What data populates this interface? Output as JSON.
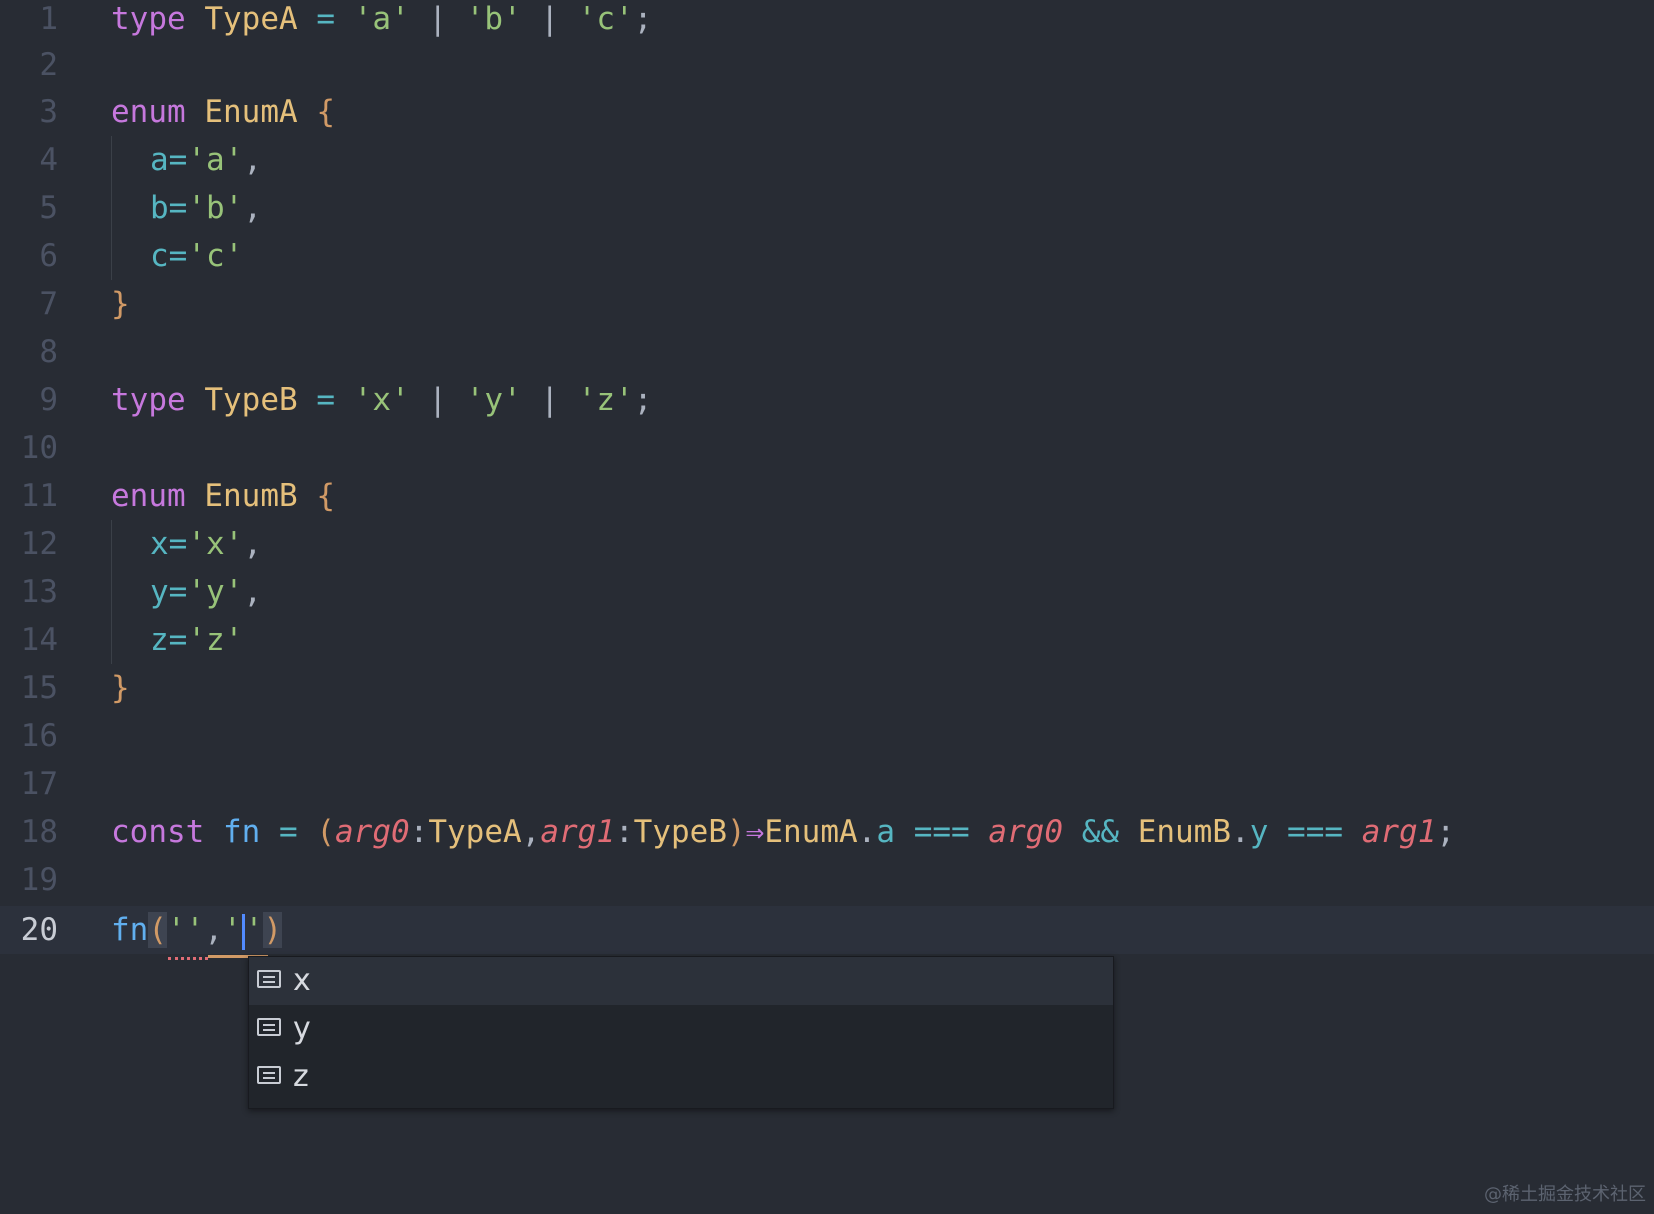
{
  "editor": {
    "lines": [
      {
        "n": "1"
      },
      {
        "n": "2"
      },
      {
        "n": "3"
      },
      {
        "n": "4"
      },
      {
        "n": "5"
      },
      {
        "n": "6"
      },
      {
        "n": "7"
      },
      {
        "n": "8"
      },
      {
        "n": "9"
      },
      {
        "n": "10"
      },
      {
        "n": "11"
      },
      {
        "n": "12"
      },
      {
        "n": "13"
      },
      {
        "n": "14"
      },
      {
        "n": "15"
      },
      {
        "n": "16"
      },
      {
        "n": "17"
      },
      {
        "n": "18"
      },
      {
        "n": "19"
      },
      {
        "n": "20"
      }
    ],
    "code": {
      "l1": {
        "kw": "type",
        "name": "TypeA",
        "eq": "=",
        "s1": "'a'",
        "bar1": "|",
        "s2": "'b'",
        "bar2": "|",
        "s3": "'c'",
        "semi": ";"
      },
      "l3": {
        "kw": "enum",
        "name": "EnumA",
        "open": "{"
      },
      "l4": {
        "prop": "a",
        "eq": "=",
        "val": "'a'",
        "comma": ","
      },
      "l5": {
        "prop": "b",
        "eq": "=",
        "val": "'b'",
        "comma": ","
      },
      "l6": {
        "prop": "c",
        "eq": "=",
        "val": "'c'"
      },
      "l7": {
        "close": "}"
      },
      "l9": {
        "kw": "type",
        "name": "TypeB",
        "eq": "=",
        "s1": "'x'",
        "bar1": "|",
        "s2": "'y'",
        "bar2": "|",
        "s3": "'z'",
        "semi": ";"
      },
      "l11": {
        "kw": "enum",
        "name": "EnumB",
        "open": "{"
      },
      "l12": {
        "prop": "x",
        "eq": "=",
        "val": "'x'",
        "comma": ","
      },
      "l13": {
        "prop": "y",
        "eq": "=",
        "val": "'y'",
        "comma": ","
      },
      "l14": {
        "prop": "z",
        "eq": "=",
        "val": "'z'"
      },
      "l15": {
        "close": "}"
      },
      "l18": {
        "kw": "const",
        "fn": "fn",
        "eq": "=",
        "lp": "(",
        "a0": "arg0",
        "c1": ":",
        "t1": "TypeA",
        "comma": ",",
        "a1": "arg1",
        "c2": ":",
        "t2": "TypeB",
        "rp": ")",
        "arrow": "⇒",
        "e1": "EnumA",
        "d1": ".",
        "p1": "a",
        "eqq1": "===",
        "a0b": "arg0",
        "and": "&&",
        "e2": "EnumB",
        "d2": ".",
        "p2": "y",
        "eqq2": "===",
        "a1b": "arg1",
        "semi": ";"
      },
      "l20": {
        "fn": "fn",
        "lp": "(",
        "s1": "''",
        "comma": ",",
        "q1": "'",
        "q2": "'",
        "rp": ")"
      }
    }
  },
  "suggestions": {
    "icon": "text-icon",
    "items": [
      {
        "label": "x"
      },
      {
        "label": "y"
      },
      {
        "label": "z"
      }
    ]
  },
  "watermark": "@稀土掘金技术社区"
}
